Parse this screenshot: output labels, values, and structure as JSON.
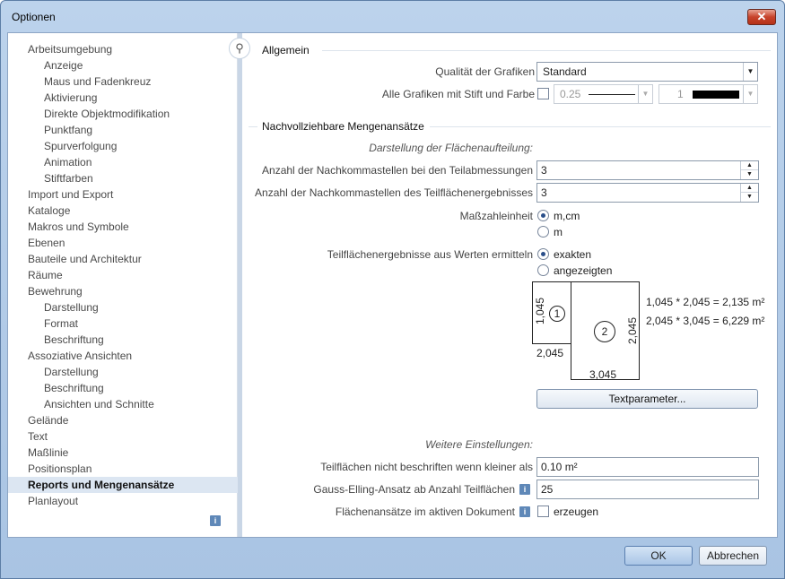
{
  "window": {
    "title": "Optionen",
    "close_glyph": "✕"
  },
  "nav": {
    "items": [
      {
        "label": "Arbeitsumgebung",
        "level": 1
      },
      {
        "label": "Anzeige",
        "level": 2
      },
      {
        "label": "Maus und Fadenkreuz",
        "level": 2
      },
      {
        "label": "Aktivierung",
        "level": 2
      },
      {
        "label": "Direkte Objektmodifikation",
        "level": 2
      },
      {
        "label": "Punktfang",
        "level": 2
      },
      {
        "label": "Spurverfolgung",
        "level": 2
      },
      {
        "label": "Animation",
        "level": 2
      },
      {
        "label": "Stiftfarben",
        "level": 2
      },
      {
        "label": "Import und Export",
        "level": 1
      },
      {
        "label": "Kataloge",
        "level": 1
      },
      {
        "label": "Makros und Symbole",
        "level": 1
      },
      {
        "label": "Ebenen",
        "level": 1
      },
      {
        "label": "Bauteile und Architektur",
        "level": 1
      },
      {
        "label": "Räume",
        "level": 1
      },
      {
        "label": "Bewehrung",
        "level": 1
      },
      {
        "label": "Darstellung",
        "level": 2
      },
      {
        "label": "Format",
        "level": 2
      },
      {
        "label": "Beschriftung",
        "level": 2
      },
      {
        "label": "Assoziative Ansichten",
        "level": 1
      },
      {
        "label": "Darstellung",
        "level": 2
      },
      {
        "label": "Beschriftung",
        "level": 2
      },
      {
        "label": "Ansichten und Schnitte",
        "level": 2
      },
      {
        "label": "Gelände",
        "level": 1
      },
      {
        "label": "Text",
        "level": 1
      },
      {
        "label": "Maßlinie",
        "level": 1
      },
      {
        "label": "Positionsplan",
        "level": 1
      },
      {
        "label": "Reports und Mengenansätze",
        "level": 1,
        "selected": true
      },
      {
        "label": "Planlayout",
        "level": 1
      }
    ],
    "info_glyph": "i",
    "search_glyph": "⚲"
  },
  "allgemein": {
    "heading": "Allgemein",
    "quality_label": "Qualität der Grafiken",
    "quality_value": "Standard",
    "pen_color_label": "Alle Grafiken mit Stift und Farbe",
    "pen_value": "0.25",
    "color_value": "1"
  },
  "mengen": {
    "heading": "Nachvollziehbare Mengenansätze",
    "subheading": "Darstellung der Flächenaufteilung:",
    "decimals_dims_label": "Anzahl der Nachkommastellen bei den Teilabmessungen",
    "decimals_dims_value": "3",
    "decimals_result_label": "Anzahl der Nachkommastellen des Teilflächenergebnisses",
    "decimals_result_value": "3",
    "unit_label": "Maßzahleinheit",
    "unit_options": [
      "m,cm",
      "m"
    ],
    "unit_selected": "m,cm",
    "calc_label": "Teilflächenergebnisse aus Werten ermitteln",
    "calc_options": [
      "exakten",
      "angezeigten"
    ],
    "calc_selected": "exakten",
    "diagram": {
      "left_height": "1,045",
      "left_width": "2,045",
      "right_height": "2,045",
      "right_width": "3,045",
      "label_1": "1",
      "label_2": "2",
      "formula_1": "1,045 * 2,045 = 2,135 m²",
      "formula_2": "2,045 * 3,045 = 6,229 m²"
    },
    "textparam_button": "Textparameter..."
  },
  "weitere": {
    "subheading": "Weitere Einstellungen:",
    "min_area_label": "Teilflächen nicht beschriften wenn kleiner als",
    "min_area_value": "0.10 m²",
    "gauss_label": "Gauss-Elling-Ansatz ab Anzahl Teilflächen",
    "gauss_value": "25",
    "doc_label": "Flächenansätze im aktiven Dokument",
    "doc_check_label": "erzeugen"
  },
  "footer": {
    "ok": "OK",
    "cancel": "Abbrechen"
  }
}
